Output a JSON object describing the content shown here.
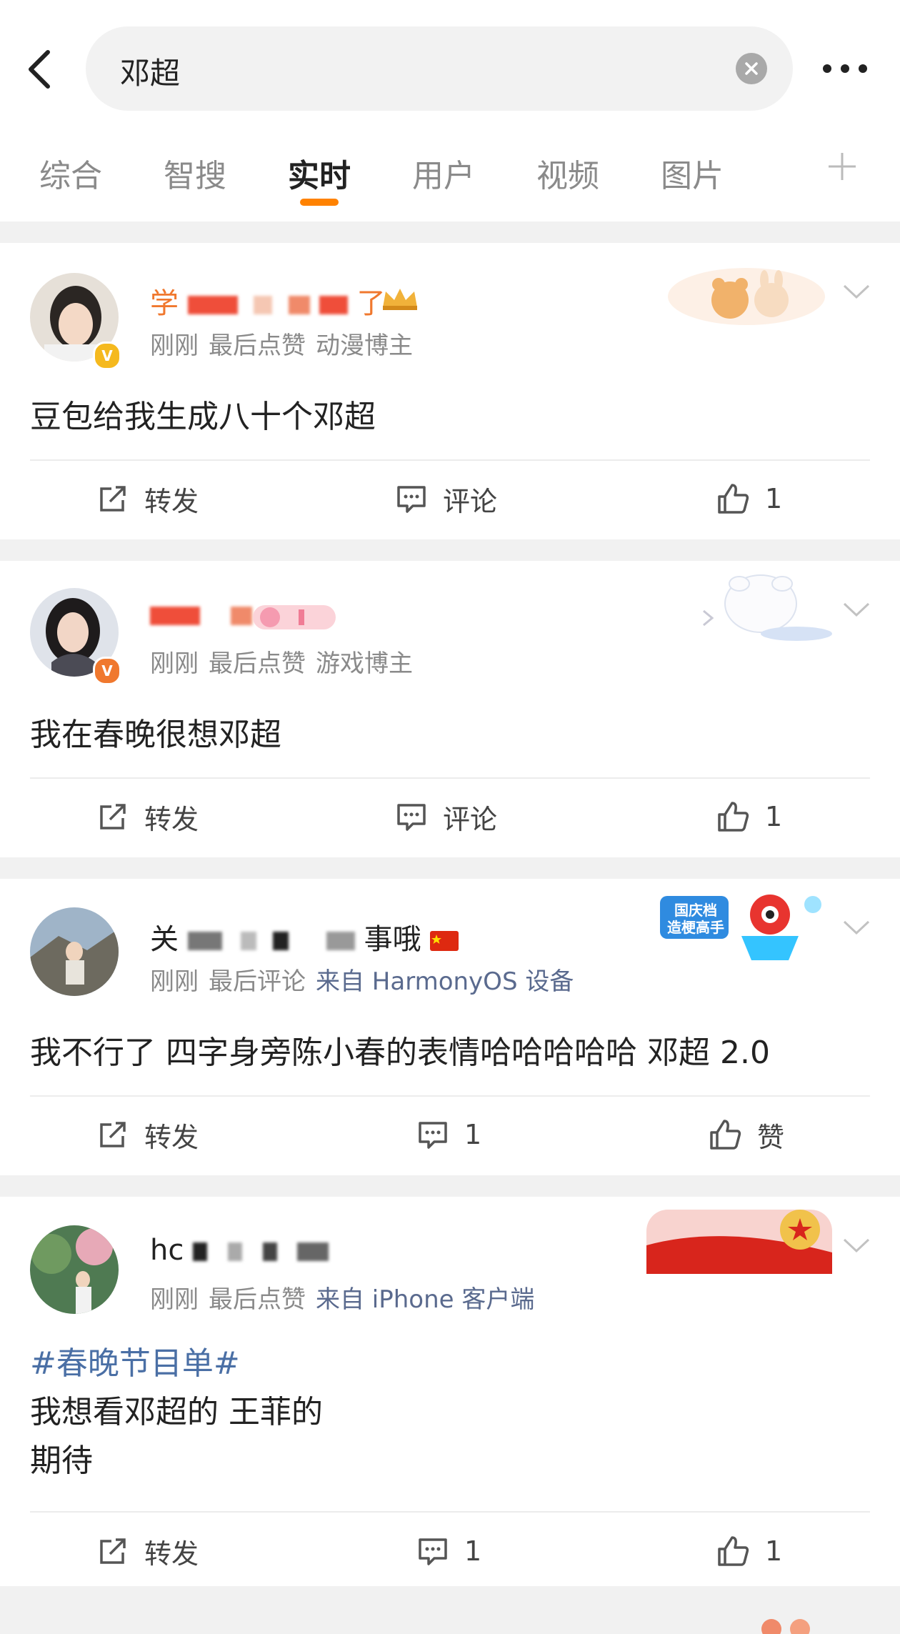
{
  "search": {
    "query": "邓超"
  },
  "tabs": [
    "综合",
    "智搜",
    "实时",
    "用户",
    "视频",
    "图片"
  ],
  "active_tab": "实时",
  "colors": {
    "accent": "#ff8200",
    "link": "#4a6fa5",
    "separator": "#f1f1f1"
  },
  "posts": [
    {
      "username_visible": "了",
      "username_prefix": "学",
      "time": "刚刚",
      "status": "最后点赞",
      "tag": "动漫博主",
      "content": "豆包给我生成八十个邓超",
      "repost_label": "转发",
      "comment_label": "评论",
      "like_count": "1"
    },
    {
      "time": "刚刚",
      "status": "最后点赞",
      "tag": "游戏博主",
      "content": "我在春晚很想邓超",
      "repost_label": "转发",
      "comment_label": "评论",
      "like_count": "1"
    },
    {
      "username_prefix": "关",
      "username_suffix": "事哦",
      "time": "刚刚",
      "status": "最后评论",
      "source": "来自 HarmonyOS 设备",
      "content": "我不行了 四字身旁陈小春的表情哈哈哈哈哈 邓超 2.0",
      "repost_label": "转发",
      "comment_count": "1",
      "like_label": "赞",
      "badge_text_1": "国庆档",
      "badge_text_2": "造梗高手"
    },
    {
      "username_prefix": "hc",
      "time": "刚刚",
      "status": "最后点赞",
      "source": "来自 iPhone 客户端",
      "hashtag": "#春晚节目单#",
      "content_line1": "我想看邓超的 王菲的",
      "content_line2": "期待",
      "repost_label": "转发",
      "comment_count": "1",
      "like_count": "1"
    }
  ]
}
